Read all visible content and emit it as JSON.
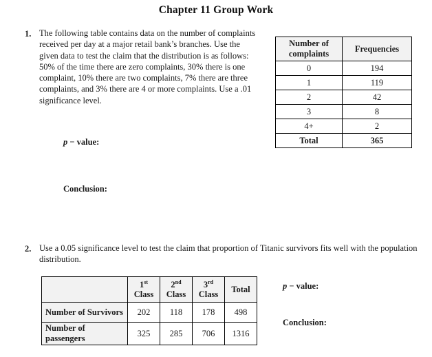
{
  "document": {
    "title": "Chapter 11 Group Work"
  },
  "questions": [
    {
      "number": "1.",
      "text": "The following table contains data on the number of complaints received per day at a major retail bank’s branches. Use the given data to test the claim that the distribution is as follows: 50% of the time there are zero complaints, 30% there is one complaint, 10% there are two complaints, 7% there are three complaints, and 3% there are 4 or more complaints. Use a .01 significance level.",
      "p_value_variable": "p",
      "p_value_label": "− value:",
      "conclusion_label": "Conclusion:"
    },
    {
      "number": "2.",
      "text": "Use a 0.05 significance level to test the claim that proportion of Titanic survivors fits well with the population distribution.",
      "p_value_variable": "p",
      "p_value_label": "− value:",
      "conclusion_label": "Conclusion:"
    }
  ],
  "table_complaints": {
    "headers": [
      "Number of complaints",
      "Frequencies"
    ],
    "header_line1_col1": "Number of",
    "header_line2_col1": "complaints",
    "header_col2": "Frequencies",
    "rows": [
      {
        "complaints": "0",
        "frequency": "194"
      },
      {
        "complaints": "1",
        "frequency": "119"
      },
      {
        "complaints": "2",
        "frequency": "42"
      },
      {
        "complaints": "3",
        "frequency": "8"
      },
      {
        "complaints": "4+",
        "frequency": "2"
      }
    ],
    "total_row": {
      "label": "Total",
      "frequency": "365"
    }
  },
  "table_titanic": {
    "corner_label": "",
    "column_headers": [
      {
        "ordinal": "1",
        "ordinal_suffix": "st",
        "unit": "Class"
      },
      {
        "ordinal": "2",
        "ordinal_suffix": "nd",
        "unit": "Class"
      },
      {
        "ordinal": "3",
        "ordinal_suffix": "rd",
        "unit": "Class"
      }
    ],
    "total_header": "Total",
    "rows": [
      {
        "label": "Number of Survivors",
        "first_class": "202",
        "second_class": "118",
        "third_class": "178",
        "total": "498"
      },
      {
        "label": "Number of passengers",
        "first_class": "325",
        "second_class": "285",
        "third_class": "706",
        "total": "1316"
      }
    ]
  }
}
